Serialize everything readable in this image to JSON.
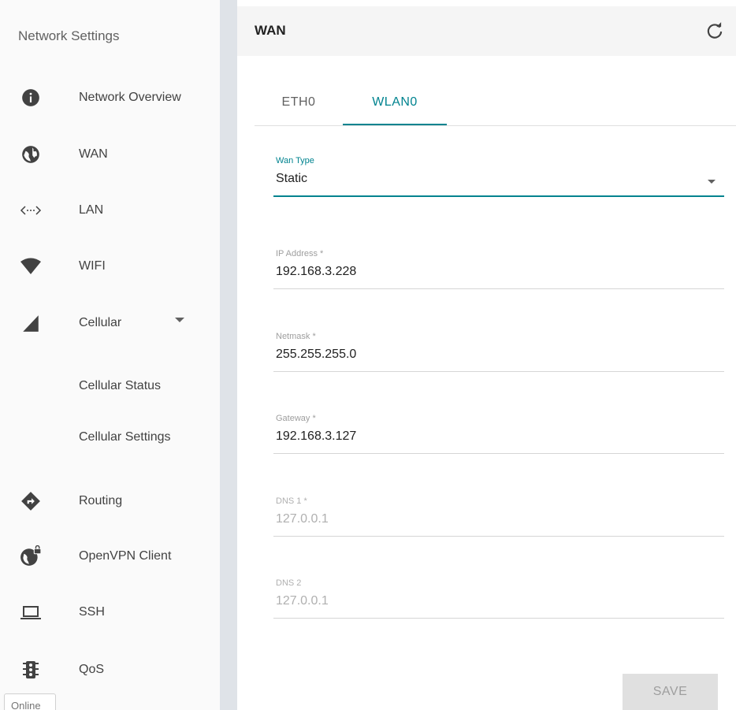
{
  "sidebar": {
    "title": "Network Settings",
    "items": [
      {
        "label": "Network Overview",
        "icon": "info-icon"
      },
      {
        "label": "WAN",
        "icon": "globe-icon"
      },
      {
        "label": "LAN",
        "icon": "code-arrows-icon"
      },
      {
        "label": "WIFI",
        "icon": "wifi-icon"
      },
      {
        "label": "Cellular",
        "icon": "signal-icon"
      },
      {
        "label": "Cellular Status"
      },
      {
        "label": "Cellular Settings"
      },
      {
        "label": "Routing",
        "icon": "directions-icon"
      },
      {
        "label": "OpenVPN Client",
        "icon": "vpn-globe-lock-icon"
      },
      {
        "label": "SSH",
        "icon": "laptop-icon"
      },
      {
        "label": "QoS",
        "icon": "traffic-light-icon"
      }
    ],
    "status": "Online"
  },
  "header": {
    "title": "WAN"
  },
  "tabs": [
    {
      "label": "ETH0"
    },
    {
      "label": "WLAN0"
    }
  ],
  "form": {
    "wan_type": {
      "label": "Wan Type",
      "value": "Static"
    },
    "ip_address": {
      "label": "IP Address *",
      "value": "192.168.3.228"
    },
    "netmask": {
      "label": "Netmask *",
      "value": "255.255.255.0"
    },
    "gateway": {
      "label": "Gateway *",
      "value": "192.168.3.127"
    },
    "dns1": {
      "label": "DNS 1 *",
      "value": "127.0.0.1"
    },
    "dns2": {
      "label": "DNS 2",
      "value": "127.0.0.1"
    }
  },
  "actions": {
    "save_label": "SAVE"
  },
  "colors": {
    "accent": "#00838f",
    "sidebar_bg": "#fafafa",
    "header_bg": "#f5f5f5",
    "divider": "#dfe3e8"
  }
}
